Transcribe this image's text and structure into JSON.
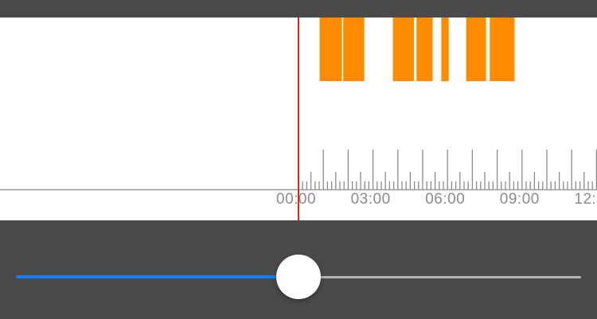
{
  "colors": {
    "background": "#4a4a4a",
    "timeline_background": "#ffffff",
    "event_block": "#ff8c00",
    "playhead": "#e0231c",
    "slider_active": "#147efb",
    "slider_inactive": "#b5b5b5"
  },
  "timeline": {
    "tick_labels": [
      {
        "text": "00:00",
        "hour": 0
      },
      {
        "text": "03:00",
        "hour": 3
      },
      {
        "text": "06:00",
        "hour": 6
      },
      {
        "text": "09:00",
        "hour": 9
      },
      {
        "text": "12:",
        "hour": 12
      }
    ],
    "event_blocks_hours": [
      [
        0.85,
        1.75
      ],
      [
        1.8,
        2.65
      ],
      [
        3.8,
        4.65
      ],
      [
        4.75,
        5.4
      ],
      [
        5.75,
        6.05
      ],
      [
        6.75,
        7.55
      ],
      [
        7.7,
        8.7
      ]
    ],
    "playhead_hour": 0
  },
  "slider": {
    "value_fraction": 0.5
  }
}
